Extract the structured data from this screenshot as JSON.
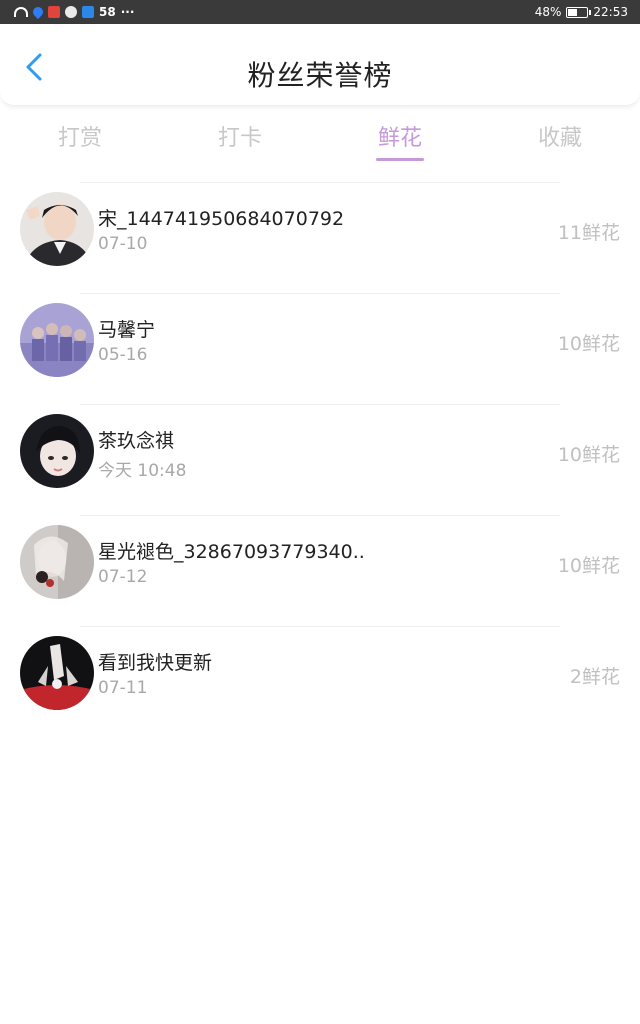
{
  "status_bar": {
    "notif_count": "58",
    "more": "···",
    "battery": "48%",
    "time": "22:53",
    "battery_level": 0.48
  },
  "header": {
    "title": "粉丝荣誉榜",
    "back_icon": "chevron-left-icon",
    "accent_color": "#2e9cf0"
  },
  "tabs": [
    {
      "label": "打赏",
      "active": false
    },
    {
      "label": "打卡",
      "active": false
    },
    {
      "label": "鲜花",
      "active": true
    },
    {
      "label": "收藏",
      "active": false
    }
  ],
  "active_tab_color": "#c69ad9",
  "fans": [
    {
      "name": "宋_144741950684070792",
      "date": "07-10",
      "count": "11鲜花"
    },
    {
      "name": "马馨宁",
      "date": "05-16",
      "count": "10鲜花"
    },
    {
      "name": "茶玖念祺",
      "date": "今天 10:48",
      "count": "10鲜花"
    },
    {
      "name": "星光褪色_32867093779340..",
      "date": "07-12",
      "count": "10鲜花"
    },
    {
      "name": "看到我快更新",
      "date": "07-11",
      "count": "2鲜花"
    }
  ]
}
